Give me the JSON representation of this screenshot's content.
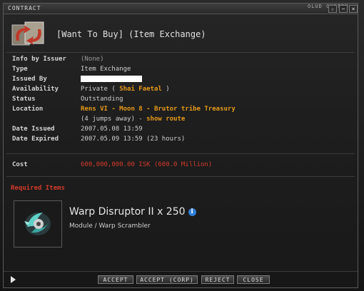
{
  "window": {
    "title": "CONTRACT",
    "behind_label": "OLUD CYSTEM",
    "controls": [
      "☆",
      "−",
      "×"
    ]
  },
  "header": {
    "title": "[Want To Buy] (Item Exchange)",
    "icon": "contract-exchange-icon"
  },
  "fields": {
    "info_by_issuer": {
      "label": "Info by Issuer",
      "value": "(None)"
    },
    "type": {
      "label": "Type",
      "value": "Item Exchange"
    },
    "issued_by": {
      "label": "Issued By",
      "value": "[redacted]"
    },
    "availability": {
      "label": "Availability",
      "prefix": "Private (",
      "name": "Shai Faetal",
      "suffix": ")"
    },
    "status": {
      "label": "Status",
      "value": "Outstanding"
    },
    "location": {
      "label": "Location",
      "value": "Rens VI - Moon 8 - Brutor tribe Treasury",
      "jumps": "(4 jumps away) -",
      "route_link": "show route"
    },
    "date_issued": {
      "label": "Date Issued",
      "value": "2007.05.08 13:59"
    },
    "date_expired": {
      "label": "Date Expired",
      "value": "2007.05.09 13:59 (23 hours)"
    },
    "cost": {
      "label": "Cost",
      "value": "600,000,000.00 ISK (600.0 Million)"
    }
  },
  "required_items": {
    "heading": "Required Items",
    "item": {
      "name": "Warp Disruptor II x 250",
      "category": "Module / Warp Scrambler",
      "icon": "warp-disruptor-icon"
    }
  },
  "footer": {
    "accept": "ACCEPT",
    "accept_corp": "ACCEPT (CORP)",
    "reject": "REJECT",
    "close": "CLOSE"
  },
  "colors": {
    "accent_orange": "#e59a1a",
    "cost_red": "#d43a2a",
    "info_blue": "#2f7fd6"
  }
}
